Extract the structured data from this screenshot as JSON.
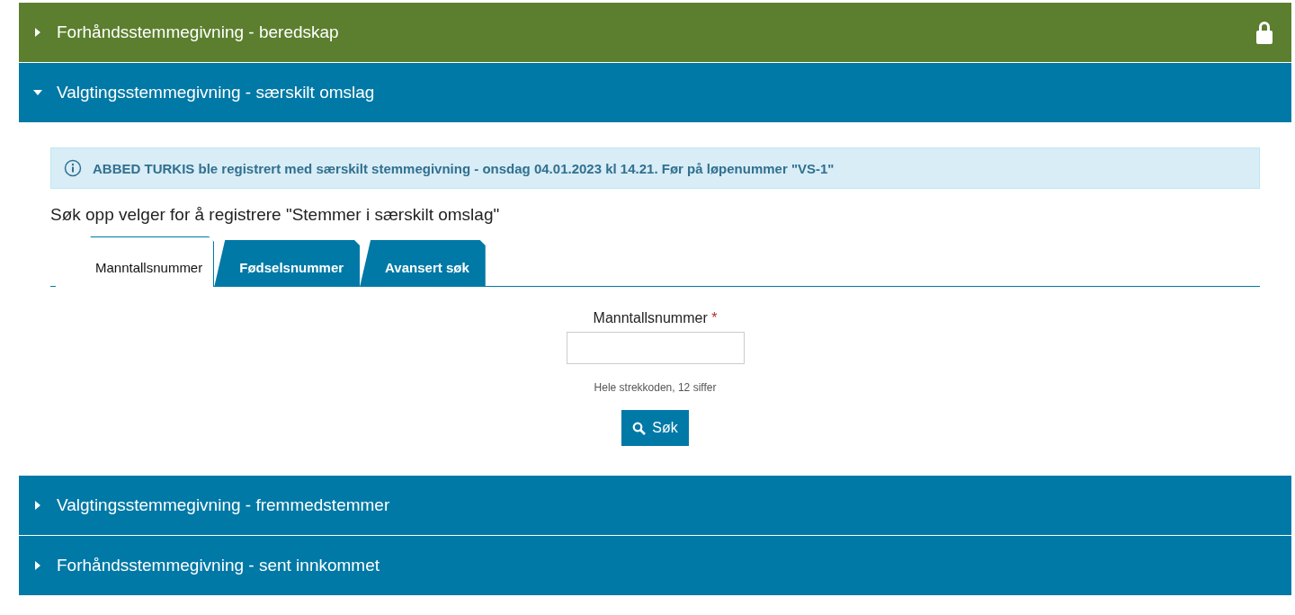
{
  "sections": [
    {
      "title": "Forhåndsstemmegivning - beredskap",
      "expanded": false,
      "locked": true,
      "color": "#5b7f2e"
    },
    {
      "title": "Valgtingsstemmegivning - særskilt omslag",
      "expanded": true,
      "locked": false,
      "color": "#0079a6"
    },
    {
      "title": "Valgtingsstemmegivning - fremmedstemmer",
      "expanded": false,
      "locked": false,
      "color": "#0079a6"
    },
    {
      "title": "Forhåndsstemmegivning - sent innkommet",
      "expanded": false,
      "locked": false,
      "color": "#0079a6"
    }
  ],
  "alert": {
    "text": "ABBED TURKIS ble registrert med særskilt stemmegivning - onsdag 04.01.2023 kl 14.21. Før på løpenummer \"VS-1\""
  },
  "heading": "Søk opp velger for å registrere \"Stemmer i særskilt omslag\"",
  "tabs": [
    {
      "label": "Manntallsnummer",
      "selected": true
    },
    {
      "label": "Fødselsnummer",
      "selected": false
    },
    {
      "label": "Avansert søk",
      "selected": false
    }
  ],
  "field": {
    "label": "Manntallsnummer",
    "required_mark": "*",
    "help": "Hele strekkoden, 12 siffer"
  },
  "button": "Søk"
}
